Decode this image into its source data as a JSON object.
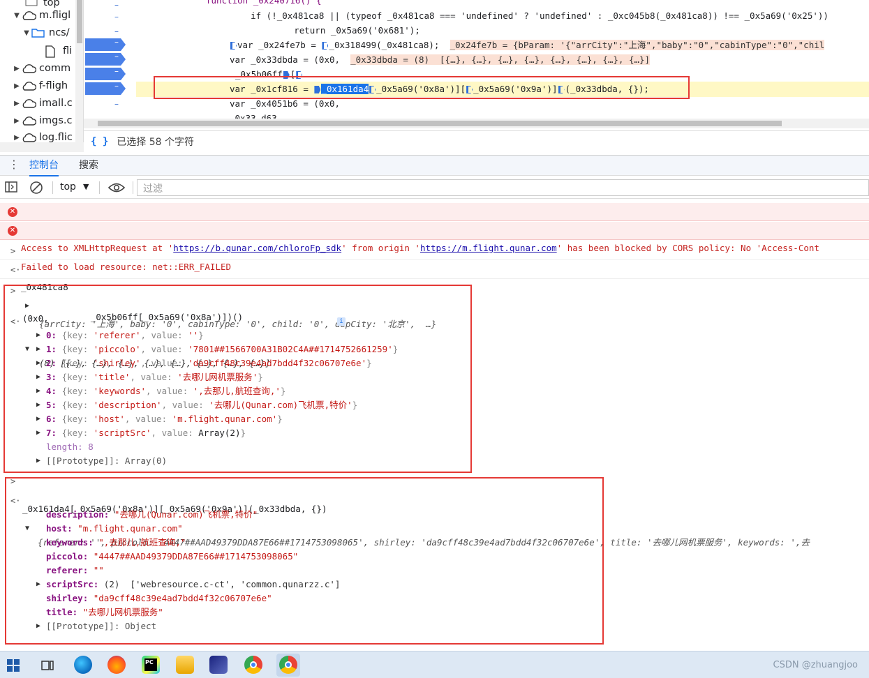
{
  "tree": {
    "items": [
      {
        "label": "top",
        "arrow": "",
        "indent": 0
      },
      {
        "label": "m.fligl",
        "arrow": "▼",
        "indent": 1
      },
      {
        "label": "ncs/",
        "arrow": "▼",
        "indent": 2
      },
      {
        "label": "fli",
        "arrow": "",
        "indent": 3
      },
      {
        "label": "comm",
        "arrow": "▶",
        "indent": 1
      },
      {
        "label": "f-fligh",
        "arrow": "▶",
        "indent": 1
      },
      {
        "label": "imall.c",
        "arrow": "▶",
        "indent": 1
      },
      {
        "label": "imgs.c",
        "arrow": "▶",
        "indent": 1
      },
      {
        "label": "log.flic",
        "arrow": "▶",
        "indent": 1
      }
    ]
  },
  "editor": {
    "gutter_dash": "–",
    "lines": [
      "function _0x240716() {",
      "    if (!_0x481ca8 || (typeof _0x481ca8 === 'undefined' ? 'undefined' : _0xc045b8(_0x481ca8)) !== _0x5a69('0x25'))",
      "        return _0x5a69('0x681');",
      "var _0x24fe7b = ",
      "var _0x33dbda = (0x0, ",
      "_0x5b06ff",
      "var _0x1cf816 = ",
      "var _0x4051b6 = (0x0,",
      "_0x33_d63"
    ],
    "line3_call": "_0x318499(_0x481ca8);",
    "line3_inline": "_0x24fe7b = {bParam: '{\"arrCity\":\"上海\",\"baby\":\"0\",\"cabinType\":\"0\",\"chil",
    "line4_inline": "_0x33dbda = (8)  [{…}, {…}, {…}, {…}, {…}, {…}, {…}, {…}]",
    "line6_selected": "_0x161da4",
    "line6_rest": "[",
    "line6_call1": "_0x5a69('0x8a')][",
    "line6_call2": "_0x5a69('0x9a')]",
    "line6_call3": "(_0x33dbda, {});"
  },
  "status": {
    "text": "已选择 58 个字符",
    "icon": "{ }"
  },
  "drawer": {
    "tabs": [
      "控制台",
      "搜索"
    ]
  },
  "toolbar": {
    "context": "top",
    "filter_placeholder": "过滤"
  },
  "console": {
    "error1_pre": "Access to XMLHttpRequest at '",
    "error1_url1": "https://b.qunar.com/chloroFp_sdk",
    "error1_mid": "' from origin '",
    "error1_url2": "https://m.flight.qunar.com",
    "error1_post": "' has been blocked by CORS policy: No 'Access-Cont",
    "error2": "Failed to load resource: net::ERR_FAILED",
    "input1": "_0x481ca8",
    "result1": "{arrCity: '上海', baby: '0', cabinType: '0', child: '0', depCity: '北京',  …}",
    "input2_line1": "(0x0,",
    "input2_line2": "             _0x5b06ff[_0x5a69('0x8a')])()",
    "result2_head": "(8) [{…}, {…}, {…}, {…}, {…}, {…}, {…}, {…}]",
    "array_items": [
      {
        "idx": "0",
        "key": "referer",
        "value": "''"
      },
      {
        "idx": "1",
        "key": "piccolo",
        "value": "'7801##1566700A31B02C4A##1714752661259'"
      },
      {
        "idx": "2",
        "key": "shirley",
        "value": "'da9cff48c39e4ad7bdd4f32c06707e6e'"
      },
      {
        "idx": "3",
        "key": "title",
        "value": "'去哪儿网机票服务'"
      },
      {
        "idx": "4",
        "key": "keywords",
        "value": "',去那儿,航班查询,'"
      },
      {
        "idx": "5",
        "key": "description",
        "value": "'去哪儿(Qunar.com)飞机票,特价'"
      },
      {
        "idx": "6",
        "key": "host",
        "value": "'m.flight.qunar.com'"
      },
      {
        "idx": "7",
        "key": "scriptSrc",
        "value": "Array(2)"
      }
    ],
    "length_label": "length: 8",
    "proto1": "[[Prototype]]: Array(0)",
    "input3": "_0x161da4[_0x5a69('0x8a')][_0x5a69('0x9a')](_0x33dbda, {})",
    "result3_head": "{referer: '', piccolo: '4447##AAD49379DDA87E66##1714753098065', shirley: 'da9cff48c39e4ad7bdd4f32c06707e6e', title: '去哪儿网机票服务', keywords: ',去",
    "obj_props": [
      {
        "key": "description",
        "value": "\"去哪儿(Qunar.com)飞机票,特价\""
      },
      {
        "key": "host",
        "value": "\"m.flight.qunar.com\""
      },
      {
        "key": "keywords",
        "value": "\",去那儿,航班查询,\""
      },
      {
        "key": "piccolo",
        "value": "\"4447##AAD49379DDA87E66##1714753098065\""
      },
      {
        "key": "referer",
        "value": "\"\""
      }
    ],
    "scriptsrc_key": "scriptSrc:",
    "scriptsrc_value": "(2)  ['webresource.c-ct', 'common.qunarzz.c']",
    "obj_props2": [
      {
        "key": "shirley",
        "value": "\"da9cff48c39e4ad7bdd4f32c06707e6e\""
      },
      {
        "key": "title",
        "value": "\"去哪儿网机票服务\""
      }
    ],
    "proto2": "[[Prototype]]: Object"
  },
  "taskbar": {
    "watermark": "CSDN @zhuangjoo"
  },
  "colors": {
    "accent": "#1a73e8",
    "error": "#e53935",
    "highlight": "#fff8c5",
    "redbox": "#e53935"
  }
}
